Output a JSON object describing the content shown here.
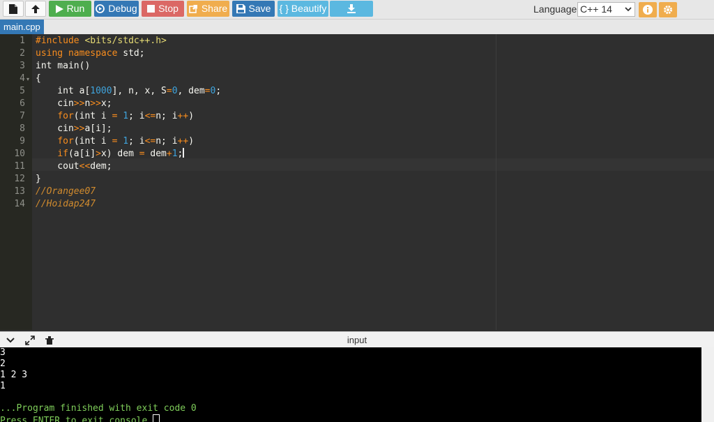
{
  "toolbar": {
    "run_label": "Run",
    "debug_label": "Debug",
    "stop_label": "Stop",
    "share_label": "Share",
    "save_label": "Save",
    "beautify_label": "{ } Beautify",
    "language_label": "Language",
    "language_value": "C++ 14",
    "language_options": [
      "C++ 14"
    ],
    "colors": {
      "run": "#4eae4e",
      "debug": "#3478b5",
      "stop": "#d9534f",
      "share": "#f0ad4e",
      "beautify": "#5bb8e0"
    }
  },
  "tabs": [
    {
      "label": "main.cpp",
      "active": true
    }
  ],
  "editor": {
    "line_numbers": [
      "1",
      "2",
      "3",
      "4",
      "5",
      "6",
      "7",
      "8",
      "9",
      "10",
      "11",
      "12",
      "13",
      "14"
    ],
    "lines": [
      "#include <bits/stdc++.h>",
      "using namespace std;",
      "int main()",
      "{",
      "    int a[1000], n, x, S=0, dem=0;",
      "    cin>>n>>x;",
      "    for(int i = 1; i<=n; i++)",
      "    cin>>a[i];",
      "    for(int i = 1; i<=n; i++)",
      "    if(a[i]>x) dem = dem+1;",
      "    cout<<dem;",
      "}",
      "//Orangee07",
      "//Hoidap247"
    ],
    "active_line": 10
  },
  "io": {
    "title": "input",
    "console_lines": [
      "3",
      "2",
      "1 2 3",
      "1",
      "",
      "...Program finished with exit code 0",
      "Press ENTER to exit console."
    ]
  }
}
